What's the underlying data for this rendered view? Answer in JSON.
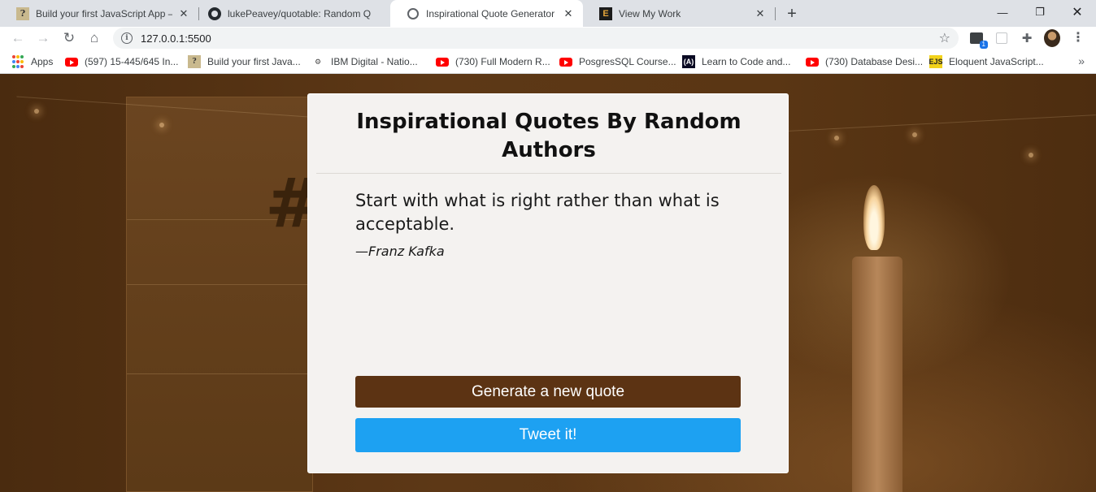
{
  "tabs": [
    {
      "title": "Build your first JavaScript App —",
      "favicon": "dc-icon",
      "active": false
    },
    {
      "title": "lukePeavey/quotable: Random Q",
      "favicon": "github-icon",
      "active": false
    },
    {
      "title": "Inspirational Quote Generator",
      "favicon": "globe-icon",
      "active": true
    },
    {
      "title": "View My Work",
      "favicon": "viewmywork-icon",
      "active": false
    }
  ],
  "toolbar": {
    "url": "127.0.0.1:5500",
    "extension_badge": "1"
  },
  "bookmarks": [
    {
      "label": "Apps",
      "icon": "apps-icon"
    },
    {
      "label": "(597) 15-445/645 In...",
      "icon": "youtube-icon"
    },
    {
      "label": "Build your first Java...",
      "icon": "dc-icon"
    },
    {
      "label": "IBM Digital - Natio...",
      "icon": "ibm-icon"
    },
    {
      "label": "(730) Full Modern R...",
      "icon": "youtube-icon"
    },
    {
      "label": "PosgresSQL Course...",
      "icon": "youtube-icon"
    },
    {
      "label": "Learn to Code and...",
      "icon": "freecodecamp-icon"
    },
    {
      "label": "(730) Database Desi...",
      "icon": "youtube-icon"
    },
    {
      "label": "Eloquent JavaScript...",
      "icon": "ejs-icon"
    }
  ],
  "page": {
    "title": "Inspirational Quotes By Random Authors",
    "quote": "Start with what is right rather than what is acceptable.",
    "author": "—Franz Kafka",
    "generate_label": "Generate a new quote",
    "tweet_label": "Tweet it!"
  },
  "colors": {
    "accent_brown": "#5c3313",
    "tweet_blue": "#1da1f2",
    "card_bg": "#f4f2f0"
  }
}
